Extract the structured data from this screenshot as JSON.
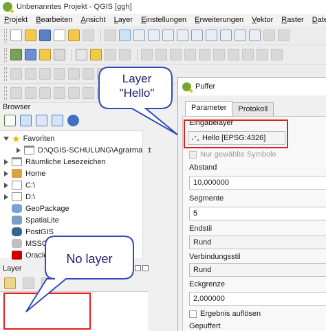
{
  "window": {
    "title": "Unbenanntes Projekt - QGIS [ggh]"
  },
  "menu": [
    "Projekt",
    "Bearbeiten",
    "Ansicht",
    "Layer",
    "Einstellungen",
    "Erweiterungen",
    "Vektor",
    "Raster",
    "Datenbank"
  ],
  "browser": {
    "title": "Browser",
    "items": [
      {
        "label": "Favoriten",
        "icon": "star-icon",
        "expanded": true
      },
      {
        "label": "D:\\QGIS-SCHULUNG\\Agrarmarkt",
        "icon": "folder-icon"
      },
      {
        "label": "Räumliche Lesezeichen",
        "icon": "bookmark-folder-icon"
      },
      {
        "label": "Home",
        "icon": "home-folder-icon"
      },
      {
        "label": "C:\\",
        "icon": "drive-icon"
      },
      {
        "label": "D:\\",
        "icon": "drive-icon"
      },
      {
        "label": "GeoPackage",
        "icon": "geopackage-icon"
      },
      {
        "label": "SpatiaLite",
        "icon": "spatialite-icon"
      },
      {
        "label": "PostGIS",
        "icon": "postgis-icon"
      },
      {
        "label": "MSSQL",
        "icon": "mssql-icon"
      },
      {
        "label": "Oracle",
        "icon": "oracle-icon"
      }
    ]
  },
  "layers": {
    "title": "Layer"
  },
  "dialog": {
    "title": "Puffer",
    "tabs": [
      "Parameter",
      "Protokoll"
    ],
    "input_layer_label": "Eingabelayer",
    "input_layer_value": "Hello [EPSG:4326]",
    "selected_only_label": "Nur gewählte Symbole",
    "distance_label": "Abstand",
    "distance_value": "10,000000",
    "segments_label": "Segmente",
    "segments_value": "5",
    "end_cap_label": "Endstil",
    "end_cap_value": "Rund",
    "join_label": "Verbindungsstil",
    "join_value": "Rund",
    "miter_label": "Eckgrenze",
    "miter_value": "2,000000",
    "dissolve_label": "Ergebnis auflösen",
    "output_label": "Gepuffert"
  },
  "annotations": {
    "layer_hello": [
      "Layer",
      "\"Hello\""
    ],
    "no_layer": "No layer",
    "box_color": "#e02020",
    "callout_border": "#2f4bb5"
  },
  "colors": {
    "accent": "#74a833",
    "bubble_fill": "#ffffff"
  }
}
